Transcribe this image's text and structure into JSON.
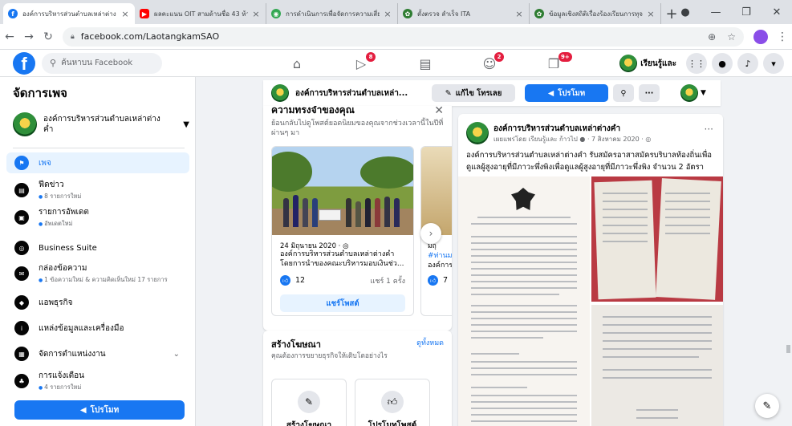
{
  "browser": {
    "tabs": [
      {
        "title": "องค์การบริหารส่วนตำบลเหล่าต่าง",
        "color": "#1877f2",
        "glyph": "f",
        "active": true
      },
      {
        "title": "ผลคะแนน OIT สามด้านชื่อ 43 ห้า",
        "color": "#ff0000",
        "glyph": "▶",
        "active": false
      },
      {
        "title": "การดำเนินการเพื่อจัดการความเสี่ย",
        "color": "#34a853",
        "glyph": "◉",
        "active": false
      },
      {
        "title": "ตั้งตรวจ สำเร็จ ITA",
        "color": "#2e7d32",
        "glyph": "✿",
        "active": false
      },
      {
        "title": "ข้อมูลเชิงสถิติเรื่องร้องเรียนการทุจริ",
        "color": "#2e7d32",
        "glyph": "✿",
        "active": false
      }
    ],
    "url": "facebook.com/LaotangkamSAO"
  },
  "fb": {
    "search_placeholder": "ค้นหาบน Facebook",
    "nav_badges": {
      "watch": "8",
      "groups": "2",
      "gaming": "9+"
    },
    "user_name": "เรียนรู้และ"
  },
  "sidebar": {
    "title": "จัดการเพจ",
    "page_name": "องค์การบริหารส่วนตำบลเหล่าต่าง ค่ำ",
    "items": [
      {
        "label": "เพจ",
        "sub": "",
        "icon": "⚑",
        "active": true
      },
      {
        "label": "ฟีดข่าว",
        "sub": "8 รายการใหม่",
        "icon": "▤",
        "active": false
      },
      {
        "label": "รายการอัพเดต",
        "sub": "อัพเดตใหม่",
        "icon": "▣",
        "active": false
      },
      {
        "label": "Business Suite",
        "sub": "",
        "icon": "◎",
        "active": false
      },
      {
        "label": "กล่องข้อความ",
        "sub": "1 ข้อความใหม่ & ความคิดเห็นใหม่ 17 รายการ",
        "icon": "✉",
        "active": false
      },
      {
        "label": "แอพธุรกิจ",
        "sub": "",
        "icon": "◆",
        "active": false
      },
      {
        "label": "แหล่งข้อมูลและเครื่องมือ",
        "sub": "",
        "icon": "i",
        "active": false
      },
      {
        "label": "จัดการตำแหน่งงาน",
        "sub": "",
        "icon": "▦",
        "active": false
      },
      {
        "label": "การแจ้งเตือน",
        "sub": "4 รายการใหม่",
        "icon": "♣",
        "active": false
      }
    ],
    "promote": "โปรโมท"
  },
  "pagebar": {
    "page_name": "องค์การบริหารส่วนตำบลเหล่า...",
    "edit": "แก้ไข โทรเลย",
    "promote": "โปรโมท"
  },
  "memories": {
    "title": "ความทรงจำของคุณ",
    "desc": "ย้อนกลับไปดูโพสต์ยอดนิยมของคุณจากช่วงเวลานี้ในปีที่ผ่านๆ มา",
    "item1": {
      "date": "24 มิถุนายน 2020 · ◎",
      "caption": "องค์การบริหารส่วนตำบลเหล่าต่างคำ โดยการนำของคณะบริหารมอบเงินช่ว...",
      "likes": "12",
      "shares": "แชร์ 1 ครั้ง",
      "share_btn": "แชร์โพสต์"
    },
    "item2": {
      "date": "มิถุ",
      "tag": "#ท่านม",
      "caption": "องค์การ",
      "likes": "7"
    }
  },
  "ad": {
    "title": "สร้างโฆษณา",
    "see_all": "ดูทั้งหมด",
    "desc": "คุณต้องการขยายธุรกิจให้เติบโตอย่างไร",
    "tiles": [
      "สร้างโฆษณา",
      "โปรโมทโพสต์"
    ]
  },
  "post": {
    "author": "องค์การบริหารส่วนตำบลเหล่าต่างคำ",
    "meta": "เผยแพร่โดย เรียนรู้และ ก้าวไป ● · 7 สิงหาคม 2020 · ◎",
    "text": "องค์การบริหารส่วนตำบลเหล่าต่างคำ รับสมัครอาสาสมัครบริบาลท้องถิ่นเพื่อดูแลผู้สูงอายุที่มีภาวะพึ่งพิงเพื่อดูแลผู้สูงอายุที่มีภาวะพึ่งพิง จำนวน 2 อัตรา"
  }
}
